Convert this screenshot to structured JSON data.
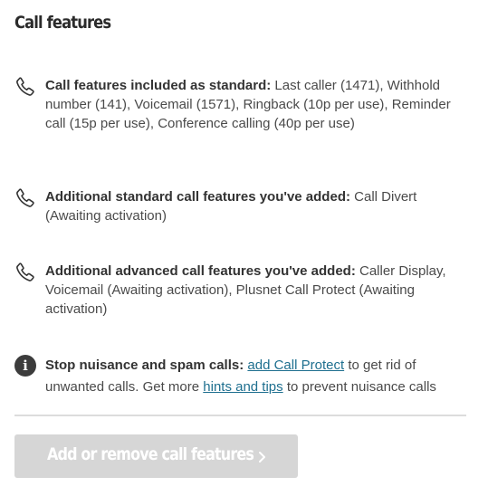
{
  "section": {
    "title": "Call features"
  },
  "features": [
    {
      "icon": "phone-icon",
      "heading": "Call features included as standard:",
      "body": "Last caller (1471), Withhold number (141), Voicemail (1571), Ringback (10p per use), Reminder call (15p per use), Conference calling (40p per use)"
    },
    {
      "icon": "phone-icon",
      "heading": "Additional standard call features you've added:",
      "body": "Call Divert (Awaiting activation)"
    },
    {
      "icon": "phone-icon",
      "heading": "Additional advanced call features you've added:",
      "body": "Caller Display, Voicemail (Awaiting activation), Plusnet Call Protect (Awaiting activation)"
    }
  ],
  "notice": {
    "icon": "info-icon",
    "icon_glyph": "i",
    "heading": "Stop nuisance and spam calls:",
    "link1": "add Call Protect",
    "text1": "to get rid of unwanted calls. Get more",
    "link2": "hints and tips",
    "text2": "to prevent nuisance calls"
  },
  "cta": {
    "label": "Add or remove call features",
    "icon": "chevron-right-icon",
    "state": "disabled",
    "background": "#d6d6d6"
  },
  "colors": {
    "link": "#1e6f8f",
    "text": "#4a4a4a",
    "divider": "#dcdcdc"
  }
}
